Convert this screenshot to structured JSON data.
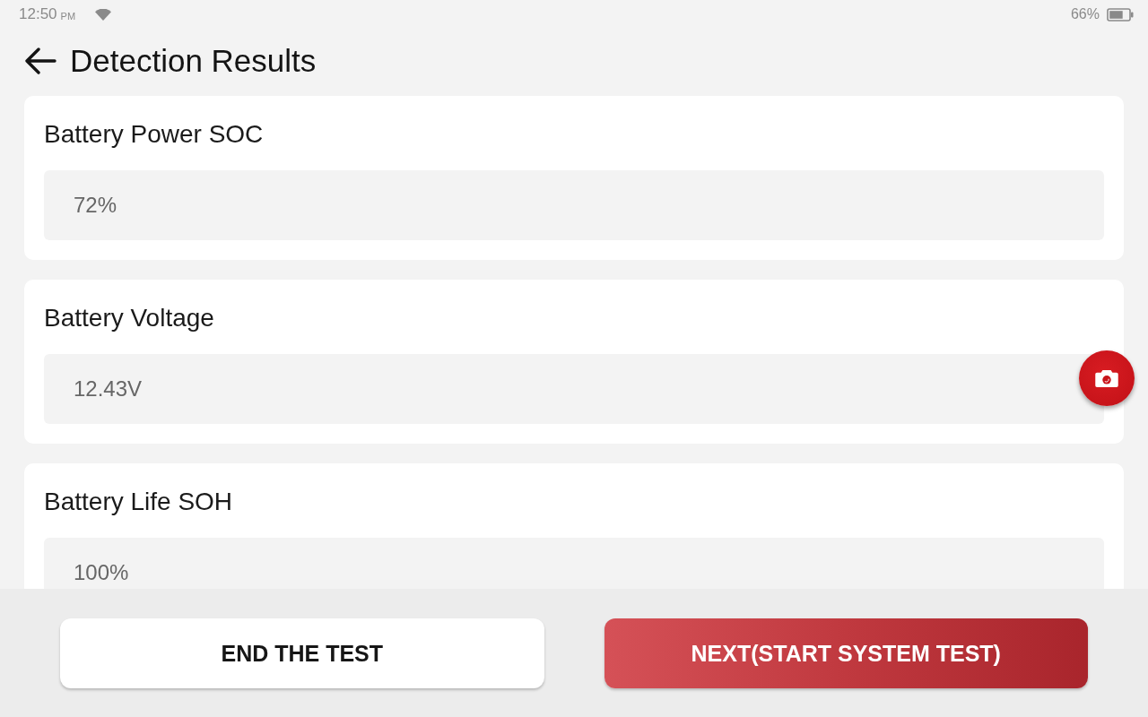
{
  "status_bar": {
    "time": "12:50",
    "meridiem": "PM",
    "battery_percent": "66%"
  },
  "header": {
    "title": "Detection Results"
  },
  "results": [
    {
      "label": "Battery Power SOC",
      "value": "72%"
    },
    {
      "label": "Battery Voltage",
      "value": "12.43V"
    },
    {
      "label": "Battery Life SOH",
      "value": "100%"
    }
  ],
  "buttons": [
    {
      "label": "END THE TEST",
      "kind": "secondary"
    },
    {
      "label": "NEXT(START SYSTEM TEST)",
      "kind": "primary"
    }
  ]
}
